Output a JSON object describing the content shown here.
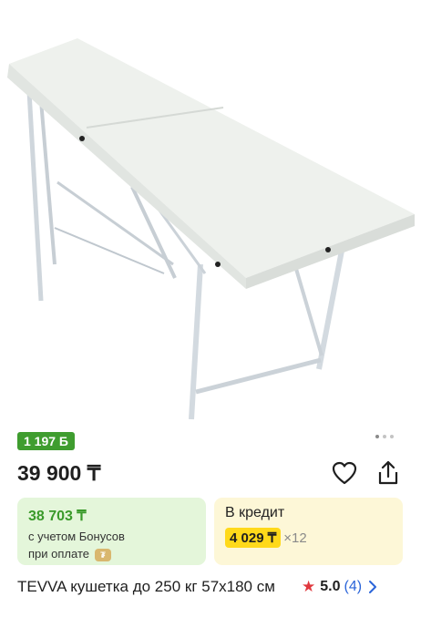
{
  "product": {
    "bonus_badge": "1 197 Б",
    "price": "39 900 ₸",
    "title": "TEVVA кушетка до 250 кг 57х180 см",
    "rating": "5.0",
    "reviews": "(4)"
  },
  "gallery": {
    "image_label": "massage table",
    "dots": 3,
    "active_dot": 0
  },
  "bonus_card": {
    "price": "38 703 ₸",
    "line1": "с учетом Бонусов",
    "line2": "при оплате"
  },
  "credit_card": {
    "label": "В кредит",
    "amount": "4 029 ₸",
    "months": "×12"
  },
  "icons": [
    "heart-icon",
    "share-icon",
    "star-icon",
    "chevron-right-icon",
    "coin-icon"
  ],
  "colors": {
    "bonus_green": "#3f9d2f",
    "credit_yellow": "#ffd91a",
    "star_red": "#e0383e",
    "link_blue": "#2b65d9"
  }
}
